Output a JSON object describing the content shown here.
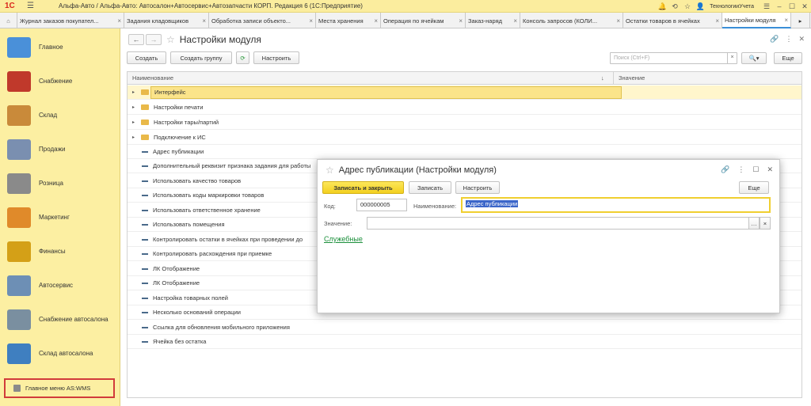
{
  "titlebar": {
    "logo": "1С",
    "title": "Альфа-Авто / Альфа-Авто: Автосалон+Автосервис+Автозапчасти КОРП. Редакция 6   (1С:Предприятие)",
    "user": "ТехнологииУчета"
  },
  "tabs": [
    {
      "label": "Журнал заказов покупател...",
      "active": false
    },
    {
      "label": "Задания кладовщиков",
      "active": false
    },
    {
      "label": "Обработка записи объекто...",
      "active": false
    },
    {
      "label": "Места хранения",
      "active": false
    },
    {
      "label": "Операция по ячейкам",
      "active": false
    },
    {
      "label": "Заказ-наряд",
      "active": false
    },
    {
      "label": "Консоль запросов (КОЛИ...",
      "active": false
    },
    {
      "label": "Остатки товаров в ячейках",
      "active": false
    },
    {
      "label": "Настройки модуля",
      "active": true
    }
  ],
  "sidebar": {
    "items": [
      {
        "label": "Главное",
        "icon": "home-icon",
        "color": "#4a90d9"
      },
      {
        "label": "Снабжение",
        "icon": "truck-icon",
        "color": "#c0392b"
      },
      {
        "label": "Склад",
        "icon": "boxes-icon",
        "color": "#c98a3a"
      },
      {
        "label": "Продажи",
        "icon": "sales-icon",
        "color": "#7a8fb0"
      },
      {
        "label": "Розница",
        "icon": "cash-register-icon",
        "color": "#8a8a8a"
      },
      {
        "label": "Маркетинг",
        "icon": "marketing-icon",
        "color": "#e08a2a"
      },
      {
        "label": "Финансы",
        "icon": "coins-icon",
        "color": "#d4a017"
      },
      {
        "label": "Автосервис",
        "icon": "service-icon",
        "color": "#6d8fb5"
      },
      {
        "label": "Снабжение автосалона",
        "icon": "calculator-icon",
        "color": "#7a8fa0"
      },
      {
        "label": "Склад автосалона",
        "icon": "warehouse-icon",
        "color": "#3f7fc0"
      }
    ],
    "wms_label": "Главное меню AS:WMS"
  },
  "main": {
    "title": "Настройки модуля",
    "toolbar": {
      "create": "Создать",
      "create_group": "Создать группу",
      "configure": "Настроить",
      "more": "Еще"
    },
    "search_placeholder": "Поиск (Ctrl+F)",
    "columns": [
      "Наименование",
      "Значение"
    ],
    "rows": [
      {
        "label": "Интерфейс",
        "type": "group",
        "selected": true
      },
      {
        "label": "Настройки печати",
        "type": "group"
      },
      {
        "label": "Настройки тары/партий",
        "type": "group"
      },
      {
        "label": "Подключение к ИС",
        "type": "group"
      },
      {
        "label": "Адрес публикации",
        "type": "item"
      },
      {
        "label": "Дополнительный реквизит признака задания для работы",
        "type": "item"
      },
      {
        "label": "Использовать качество товаров",
        "type": "item"
      },
      {
        "label": "Использовать коды маркировки товаров",
        "type": "item"
      },
      {
        "label": "Использовать ответственное хранение",
        "type": "item"
      },
      {
        "label": "Использовать помещения",
        "type": "item"
      },
      {
        "label": "Контролировать остатки в ячейках при проведении до",
        "type": "item"
      },
      {
        "label": "Контролировать расхождения при приемке",
        "type": "item"
      },
      {
        "label": "ЛК Отображение",
        "type": "item"
      },
      {
        "label": "ЛК Отображение",
        "type": "item"
      },
      {
        "label": "Настройка товарных полей",
        "type": "item"
      },
      {
        "label": "Несколько оснований операции",
        "type": "item"
      },
      {
        "label": "Ссылка для обновления мобильного приложения",
        "type": "item"
      },
      {
        "label": "Ячейка без остатка",
        "type": "item"
      }
    ]
  },
  "dialog": {
    "title": "Адрес публикации (Настройки модуля)",
    "save_close": "Записать и закрыть",
    "save": "Записать",
    "configure": "Настроить",
    "more": "Еще",
    "code_label": "Код:",
    "code_value": "000000005",
    "name_label": "Наименование:",
    "name_value": "Адрес публикации",
    "value_label": "Значение:",
    "value_value": "",
    "service_link": "Служебные"
  }
}
